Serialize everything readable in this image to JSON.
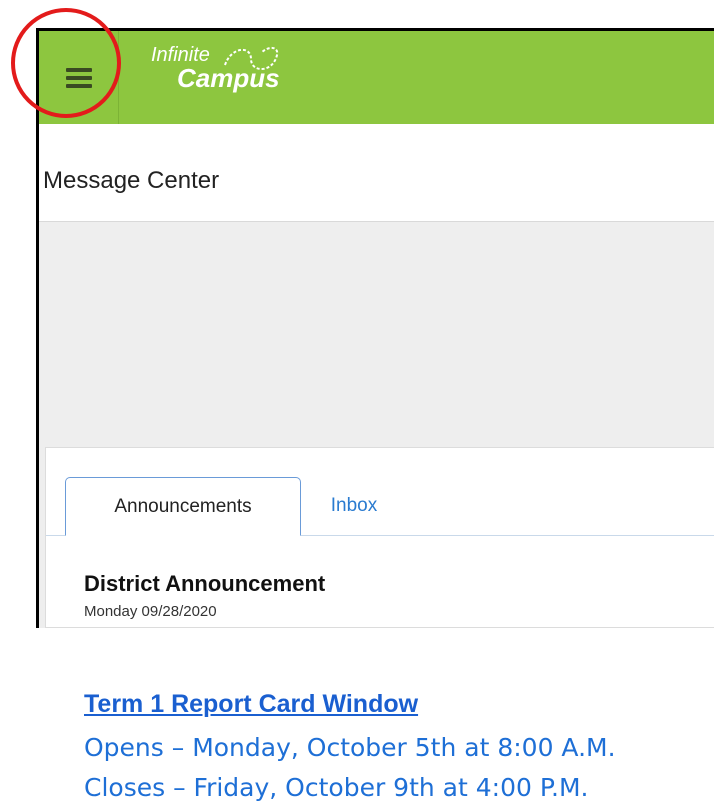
{
  "header": {
    "logo_line1": "Infinite",
    "logo_line2": "Campus",
    "menu_icon": "hamburger-menu-icon",
    "bar_color": "#8dc63f"
  },
  "page": {
    "title": "Message Center"
  },
  "tabs": [
    {
      "label": "Announcements",
      "active": true
    },
    {
      "label": "Inbox",
      "active": false
    }
  ],
  "announcement": {
    "title": "District Announcement",
    "date": "Monday 09/28/2020",
    "link_title": "Term 1 Report Card Window",
    "lines": [
      "Opens – Monday, October 5th at 8:00 A.M.",
      "Closes – Friday, October 9th at 4:00 P.M."
    ]
  },
  "annotation": {
    "color": "#e31b1b"
  }
}
